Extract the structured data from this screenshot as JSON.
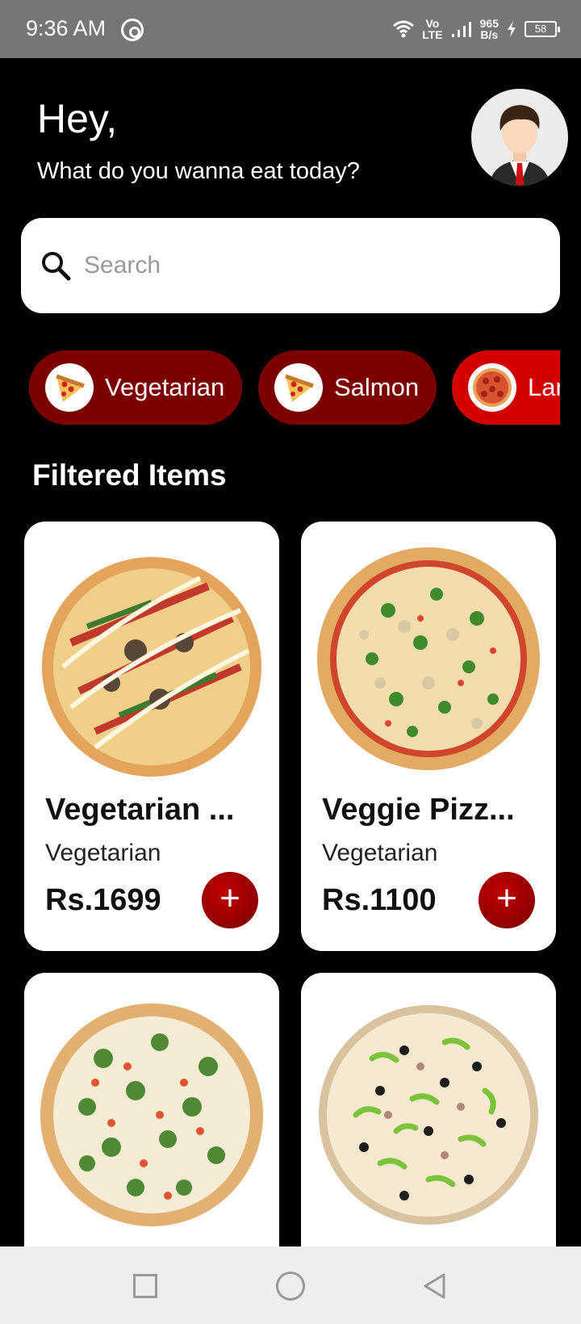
{
  "status_bar": {
    "time": "9:36 AM",
    "network_top": "Vo",
    "network_bottom": "LTE",
    "speed_value": "965",
    "speed_unit": "B/s",
    "battery": "58"
  },
  "header": {
    "greeting": "Hey,",
    "subtitle": "What do you wanna eat today?"
  },
  "search": {
    "placeholder": "Search"
  },
  "categories": [
    {
      "label": "Vegetarian",
      "icon": "pizza-slice-icon"
    },
    {
      "label": "Salmon",
      "icon": "pizza-slice-icon"
    },
    {
      "label": "Lar",
      "icon": "pepperoni-pizza-icon"
    }
  ],
  "section_title": "Filtered Items",
  "items": [
    {
      "name": "Vegetarian ...",
      "category": "Vegetarian",
      "price": "Rs.1699",
      "add_label": "+"
    },
    {
      "name": "Veggie Pizz...",
      "category": "Vegetarian",
      "price": "Rs.1100",
      "add_label": "+"
    },
    {
      "name": "",
      "category": "",
      "price": "",
      "add_label": ""
    },
    {
      "name": "",
      "category": "",
      "price": "",
      "add_label": ""
    }
  ],
  "colors": {
    "accent_dark": "#7c0000",
    "accent_active": "#d40000",
    "background": "#000000"
  }
}
